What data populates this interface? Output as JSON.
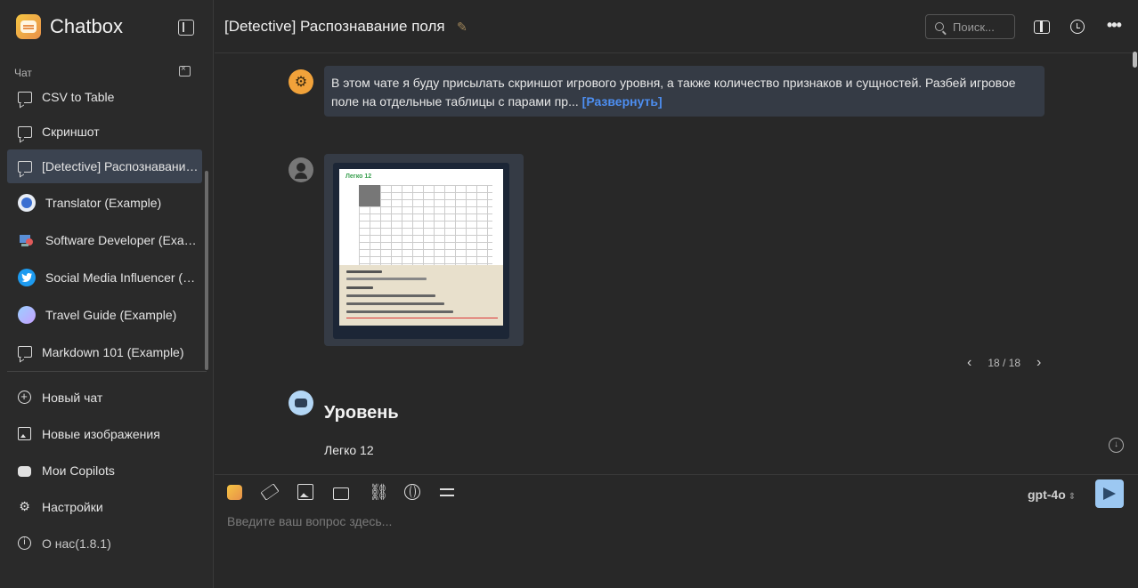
{
  "app": {
    "title": "Chatbox"
  },
  "sidebar": {
    "section_label": "Чат",
    "chats": [
      {
        "label": "CSV to Table",
        "icon": "chat-bubble-icon"
      },
      {
        "label": "Скриншот",
        "icon": "chat-bubble-icon"
      },
      {
        "label": "[Detective] Распознавание поля",
        "icon": "chat-bubble-icon",
        "selected": true
      },
      {
        "label": "Translator (Example)",
        "icon": "translator-avatar-icon"
      },
      {
        "label": "Software Developer (Example)",
        "icon": "developer-avatar-icon"
      },
      {
        "label": "Social Media Influencer (Example)",
        "icon": "twitter-avatar-icon"
      },
      {
        "label": "Travel Guide (Example)",
        "icon": "travel-avatar-icon"
      },
      {
        "label": "Markdown 101 (Example)",
        "icon": "markdown-avatar-icon"
      }
    ],
    "nav": [
      {
        "label": "Новый чат",
        "icon": "plus-circle-icon"
      },
      {
        "label": "Новые изображения",
        "icon": "image-plus-icon"
      },
      {
        "label": "Мои Copilots",
        "icon": "robot-icon"
      },
      {
        "label": "Настройки",
        "icon": "gear-icon"
      },
      {
        "label": "О нас(1.8.1)",
        "icon": "info-icon"
      }
    ]
  },
  "header": {
    "title": "[Detective] Распознавание поля",
    "search_placeholder": "Поиск..."
  },
  "messages": {
    "system_text": "В этом чате я буду присылать скриншот игрового уровня, а также количество признаков и сущностей. Разбей игровое поле на отдельные таблицы с парами пр...",
    "expand_label": "[Развернуть]",
    "image_thumb": {
      "title": "Легко 12"
    },
    "pager": {
      "current": "18",
      "total": "18",
      "text": "18 / 18"
    },
    "assistant_heading": "Уровень",
    "assistant_text": "Легко 12"
  },
  "composer": {
    "model": "gpt-4o",
    "placeholder": "Введите ваш вопрос здесь..."
  },
  "colors": {
    "accent": "#4d8ef0",
    "send_button": "#9cc8f2",
    "selected_chat": "#3b4350",
    "system_avatar": "#f1a23a",
    "bot_avatar": "#b3d6f5"
  }
}
